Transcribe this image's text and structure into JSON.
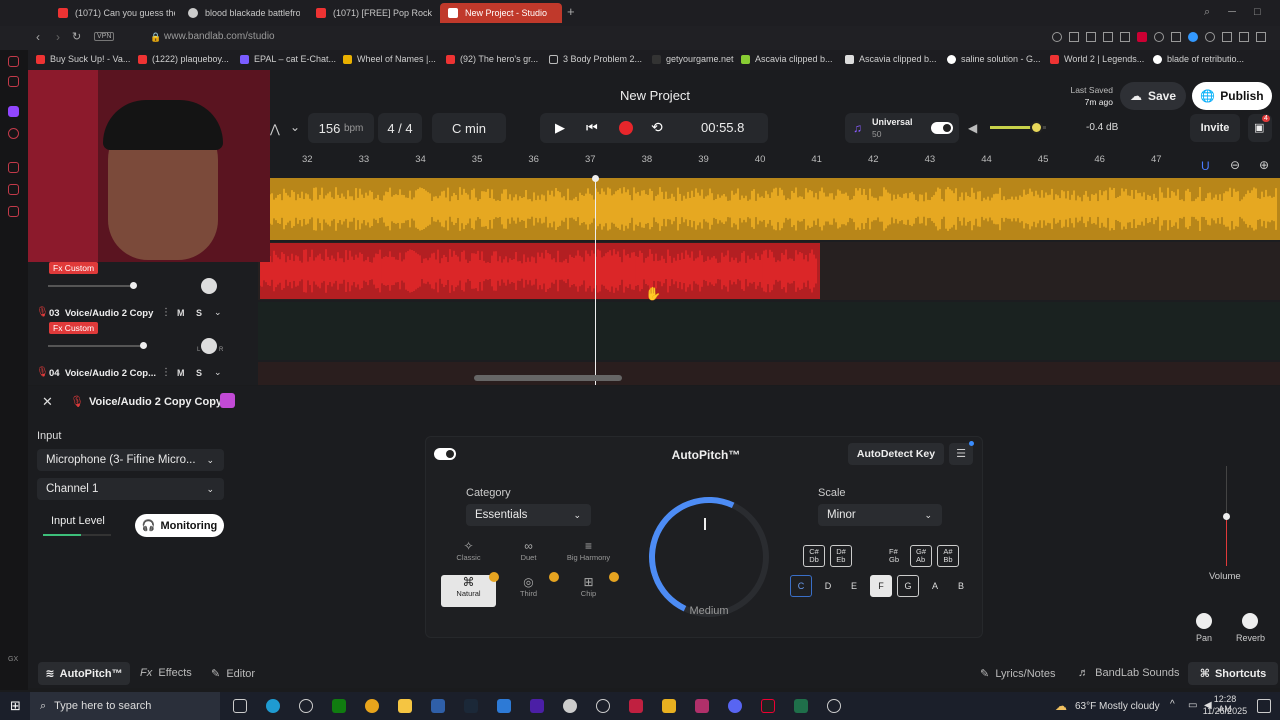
{
  "browser": {
    "tabs": [
      {
        "label": "(1071) Can you guess the",
        "fav": "#e33"
      },
      {
        "label": "blood blackade battlefron",
        "fav": "#ccc"
      },
      {
        "label": "(1071) [FREE] Pop Rock x",
        "fav": "#e33"
      },
      {
        "label": "New Project - Studio",
        "fav": "#fff"
      }
    ],
    "url": "www.bandlab.com/studio",
    "vpn": "VPN",
    "bookmarks": [
      "Buy Suck Up! - Va...",
      "(1222) plaqueboy...",
      "EPAL – cat E-Chat...",
      "Wheel of Names |...",
      "(92) The hero's gr...",
      "3 Body Problem 2...",
      "getyourgame.net",
      "Ascavia clipped b...",
      "Ascavia clipped b...",
      "saline solution - G...",
      "World 2 | Legends...",
      "blade of retributio..."
    ]
  },
  "header": {
    "title": "New Project",
    "tempo": "156",
    "tempo_unit": "bpm",
    "time_sig": "4 / 4",
    "key": "C min",
    "time": "00:55.8",
    "universal": "Universal",
    "universal_num": "50",
    "volume_db": "-0.4 dB",
    "last_saved": "Last Saved",
    "last_saved_ago": "7m ago",
    "save": "Save",
    "publish": "Publish",
    "invite": "Invite",
    "badge": "4"
  },
  "ruler": [
    "32",
    "33",
    "34",
    "35",
    "36",
    "37",
    "38",
    "39",
    "40",
    "41",
    "42",
    "43",
    "44",
    "45",
    "46",
    "47"
  ],
  "tracks": [
    {
      "fx": "Fx Custom"
    },
    {
      "num": "03",
      "name": "Voice/Audio 2 Copy",
      "fx": "Fx Custom",
      "m": "M",
      "s": "S",
      "l": "L",
      "r": "R"
    },
    {
      "num": "04",
      "name": "Voice/Audio 2 Cop...",
      "m": "M",
      "s": "S"
    }
  ],
  "panel": {
    "track_title": "Voice/Audio 2 Copy Copy",
    "input_label": "Input",
    "input_device": "Microphone (3- Fifine Micro...",
    "channel": "Channel 1",
    "input_level": "Input Level",
    "monitoring": "Monitoring",
    "autopitch": {
      "title": "AutoPitch™",
      "autodetect": "AutoDetect Key",
      "category_label": "Category",
      "category": "Essentials",
      "scale_label": "Scale",
      "scale": "Minor",
      "amount": "Medium",
      "modes": [
        "Classic",
        "Duet",
        "Big Harmony",
        "Natural",
        "Third",
        "Chip"
      ],
      "sharps": [
        "C#\nDb",
        "D#\nEb",
        "F#\nGb",
        "G#\nAb",
        "A#\nBb"
      ],
      "naturals": [
        "C",
        "D",
        "E",
        "F",
        "G",
        "A",
        "B"
      ]
    },
    "volume": "Volume",
    "pan": "Pan",
    "reverb": "Reverb",
    "tabs": [
      "AutoPitch™",
      "Effects",
      "Editor"
    ],
    "right_tabs": [
      "Lyrics/Notes",
      "BandLab Sounds",
      "Shortcuts"
    ]
  },
  "taskbar": {
    "search": "Type here to search",
    "weather": "63°F  Mostly cloudy",
    "time": "12:28 AM",
    "date": "11/26/2025"
  },
  "colors": {
    "accent": "#e03a3a",
    "track1": "#f5b324",
    "track2": "#e8292b"
  }
}
